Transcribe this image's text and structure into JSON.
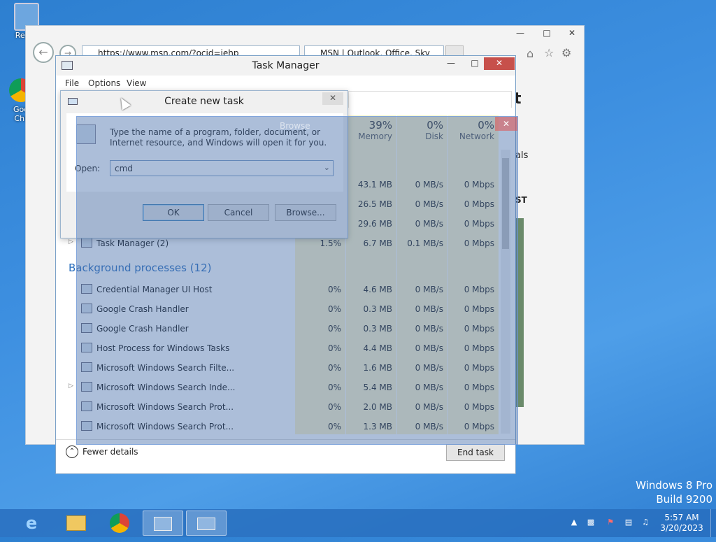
{
  "desktop": {
    "icons": [
      {
        "label": "Recycle Bin",
        "visible_label": "Recyc"
      },
      {
        "label": "Google Chrome",
        "visible_label": "Goo Chr"
      }
    ],
    "watermark": {
      "line1": "Windows 8 Pro",
      "line2": "Build 9200"
    }
  },
  "browser": {
    "address": "https://www.msn.com/?ocid=iehp",
    "tab_title": "MSN | Outlook, Office, Sky",
    "side_text_1": "t",
    "side_text_2": "als",
    "side_text_3": "ST"
  },
  "task_manager": {
    "title": "Task Manager",
    "menu": [
      "File",
      "Options",
      "View"
    ],
    "columns": [
      {
        "pct": "39%",
        "label": "Memory"
      },
      {
        "pct": "0%",
        "label": "Disk"
      },
      {
        "pct": "0%",
        "label": "Network"
      }
    ],
    "apps_rows": [
      {
        "name": "",
        "cpu": "",
        "mem": "43.1 MB",
        "disk": "0 MB/s",
        "net": "0 Mbps"
      },
      {
        "name": "",
        "cpu": "",
        "mem": "26.5 MB",
        "disk": "0 MB/s",
        "net": "0 Mbps"
      },
      {
        "name": "",
        "cpu": "",
        "mem": "29.6 MB",
        "disk": "0 MB/s",
        "net": "0 Mbps"
      },
      {
        "name": "Task Manager (2)",
        "cpu": "1.5%",
        "mem": "6.7 MB",
        "disk": "0.1 MB/s",
        "net": "0 Mbps"
      }
    ],
    "background_header": "Background processes (12)",
    "bg_rows": [
      {
        "name": "Credential Manager UI Host",
        "cpu": "0%",
        "mem": "4.6 MB",
        "disk": "0 MB/s",
        "net": "0 Mbps"
      },
      {
        "name": "Google Crash Handler",
        "cpu": "0%",
        "mem": "0.3 MB",
        "disk": "0 MB/s",
        "net": "0 Mbps"
      },
      {
        "name": "Google Crash Handler",
        "cpu": "0%",
        "mem": "0.3 MB",
        "disk": "0 MB/s",
        "net": "0 Mbps"
      },
      {
        "name": "Host Process for Windows Tasks",
        "cpu": "0%",
        "mem": "4.4 MB",
        "disk": "0 MB/s",
        "net": "0 Mbps"
      },
      {
        "name": "Microsoft Windows Search Filte...",
        "cpu": "0%",
        "mem": "1.6 MB",
        "disk": "0 MB/s",
        "net": "0 Mbps"
      },
      {
        "name": "Microsoft Windows Search Inde...",
        "cpu": "0%",
        "mem": "5.4 MB",
        "disk": "0 MB/s",
        "net": "0 Mbps"
      },
      {
        "name": "Microsoft Windows Search Prot...",
        "cpu": "0%",
        "mem": "2.0 MB",
        "disk": "0 MB/s",
        "net": "0 Mbps"
      },
      {
        "name": "Microsoft Windows Search Prot...",
        "cpu": "0%",
        "mem": "1.3 MB",
        "disk": "0 MB/s",
        "net": "0 Mbps"
      }
    ],
    "fewer_details": "Fewer details",
    "end_task": "End task"
  },
  "dialog": {
    "title": "Create new task",
    "description": "Type the name of a program, folder, document, or Internet resource, and Windows will open it for you.",
    "open_label": "Open:",
    "open_value": "cmd",
    "ok": "OK",
    "cancel": "Cancel",
    "browse": "Browse...",
    "ghost_browse": "Browse"
  },
  "taskbar": {
    "clock_time": "5:57 AM",
    "clock_date": "3/20/2023"
  }
}
